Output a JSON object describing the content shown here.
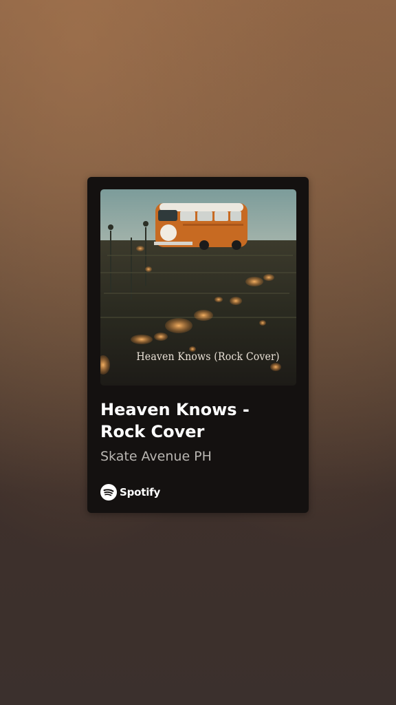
{
  "track": {
    "title": "Heaven Knows - Rock Cover",
    "artist": "Skate Avenue PH",
    "album_art_caption": "Heaven Knows (Rock Cover)"
  },
  "brand": {
    "name": "Spotify",
    "icon": "spotify-logo-icon"
  },
  "colors": {
    "card_background": "#141110",
    "title_text": "#ffffff",
    "artist_text": "#b9b6b2",
    "page_background_top": "#8c6446",
    "page_background_bottom": "#3b302d"
  }
}
